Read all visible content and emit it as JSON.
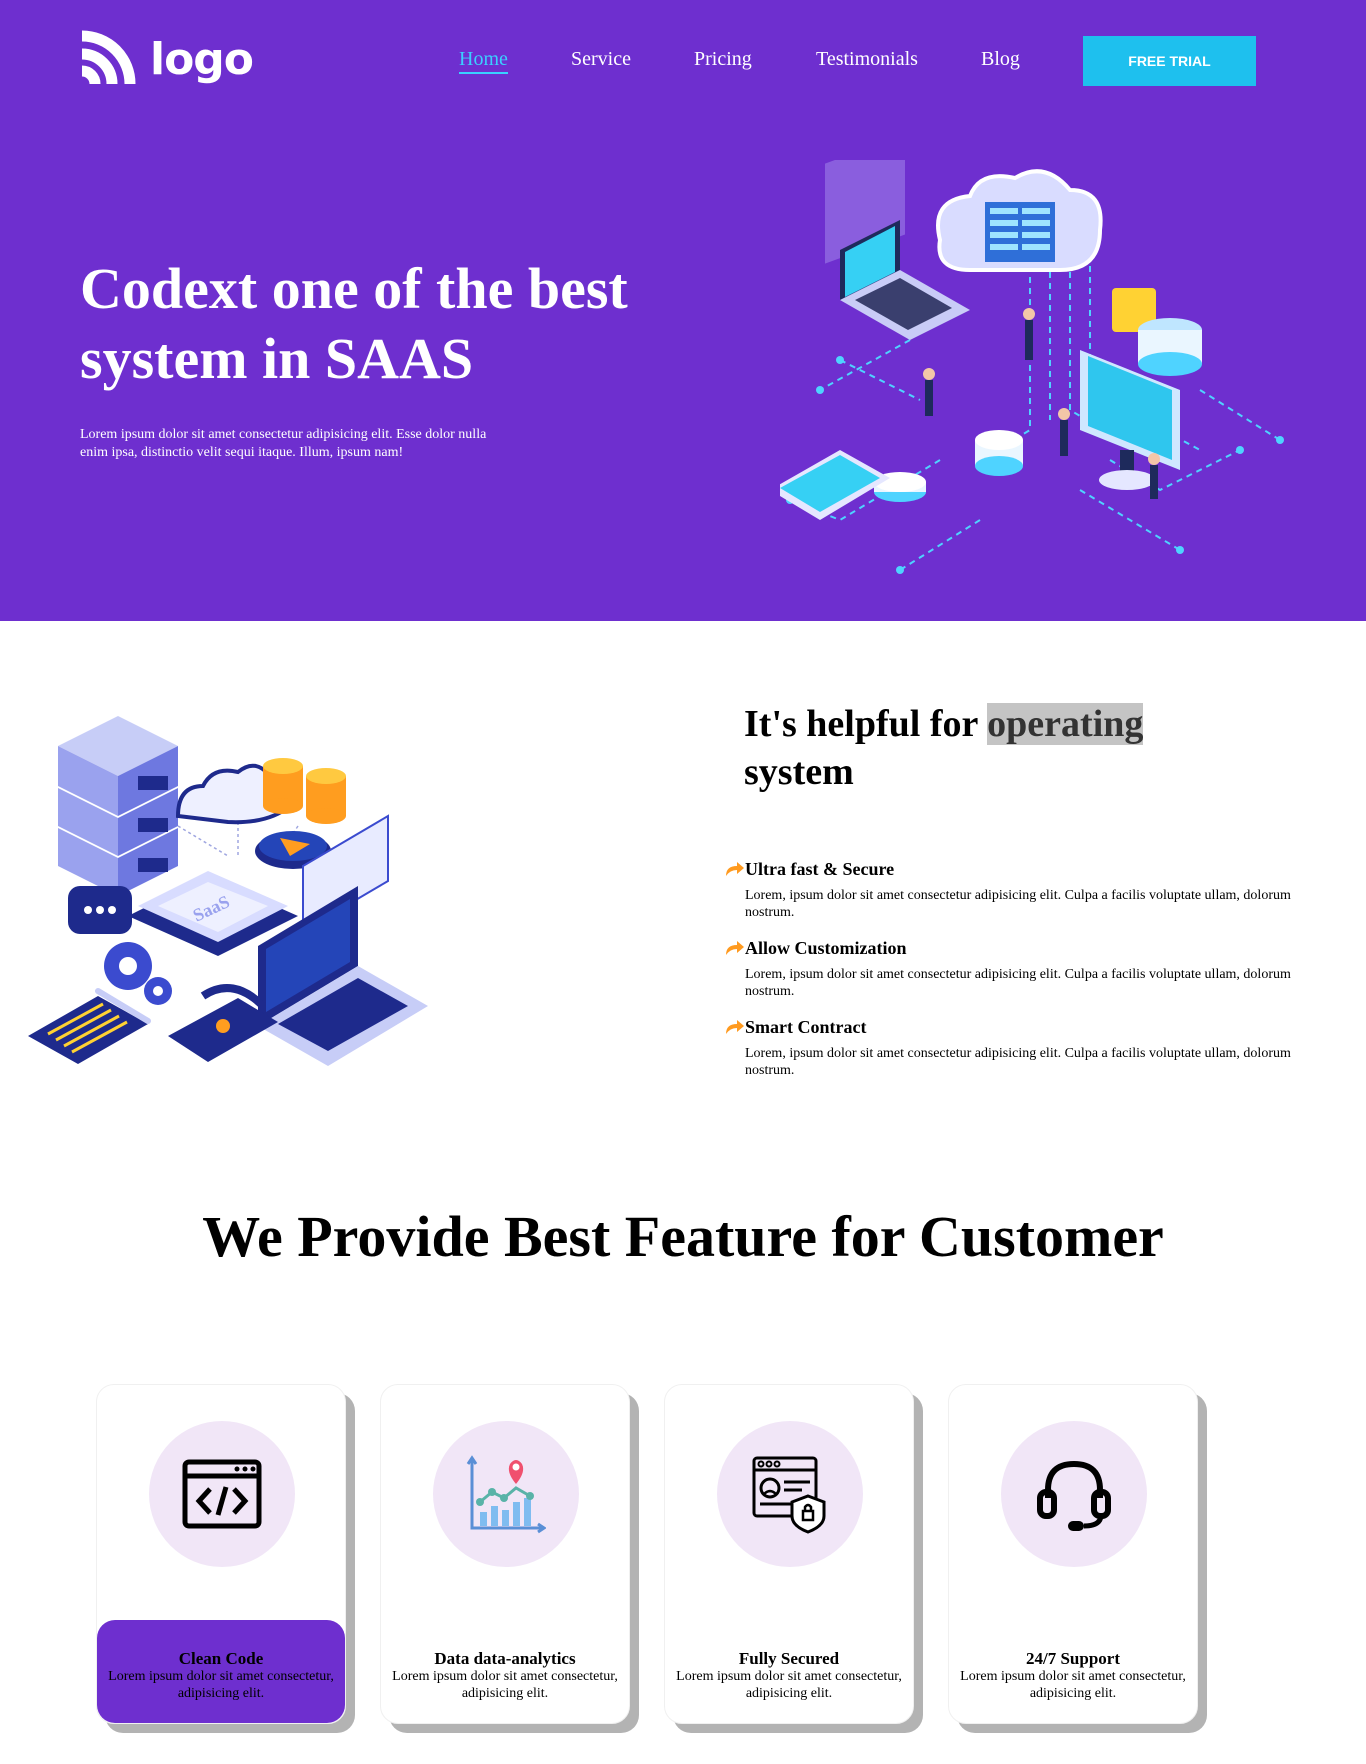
{
  "brand": {
    "logo_text": "logo"
  },
  "nav": {
    "items": [
      {
        "label": "Home",
        "active": true
      },
      {
        "label": "Service"
      },
      {
        "label": "Pricing"
      },
      {
        "label": "Testimonials"
      },
      {
        "label": "Blog"
      }
    ],
    "cta_label": "FREE TRIAL"
  },
  "hero": {
    "title": "Codext one of the best system in SAAS",
    "description": "Lorem ipsum dolor sit amet consectetur adipisicing elit. Esse dolor nulla enim ipsa, distinctio velit sequi itaque. Illum, ipsum nam!"
  },
  "helpful": {
    "title_part1": "It's helpful for ",
    "title_highlight": "operating",
    "title_part2": " system",
    "illustration_label": "SaaS",
    "features": [
      {
        "title": "Ultra fast & Secure",
        "text": "Lorem, ipsum dolor sit amet consectetur adipisicing elit. Culpa a facilis voluptate ullam, dolorum nostrum."
      },
      {
        "title": "Allow Customization",
        "text": "Lorem, ipsum dolor sit amet consectetur adipisicing elit. Culpa a facilis voluptate ullam, dolorum nostrum."
      },
      {
        "title": "Smart Contract",
        "text": "Lorem, ipsum dolor sit amet consectetur adipisicing elit. Culpa a facilis voluptate ullam, dolorum nostrum."
      }
    ]
  },
  "features_section": {
    "title": "We Provide Best Feature for Customer",
    "cards": [
      {
        "title": "Clean Code",
        "text": "Lorem ipsum dolor sit amet consectetur, adipisicing elit.",
        "icon": "code-window-icon",
        "active": true
      },
      {
        "title": "Data data-analytics",
        "text": "Lorem ipsum dolor sit amet consectetur, adipisicing elit.",
        "icon": "analytics-chart-icon"
      },
      {
        "title": "Fully Secured",
        "text": "Lorem ipsum dolor sit amet consectetur, adipisicing elit.",
        "icon": "secure-profile-icon"
      },
      {
        "title": "24/7 Support",
        "text": "Lorem ipsum dolor sit amet consectetur, adipisicing elit.",
        "icon": "headset-icon"
      }
    ]
  },
  "colors": {
    "primary": "#6e2fcf",
    "accent": "#1ec0ee",
    "nav_active": "#3ad0ff",
    "circle_bg": "#f1e6f7",
    "arrow": "#ff9a1f"
  }
}
